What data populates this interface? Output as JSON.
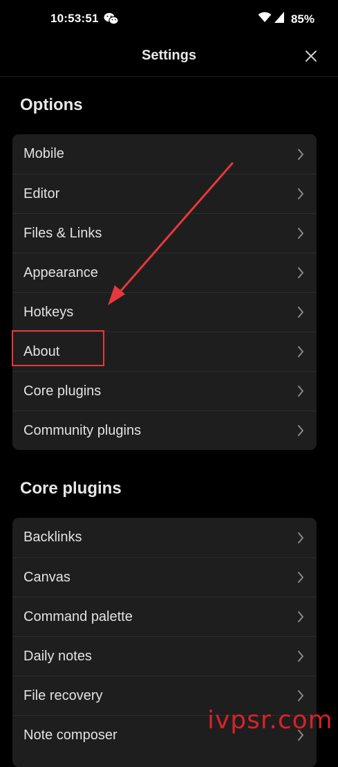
{
  "status_bar": {
    "time": "10:53:51",
    "battery": "85%",
    "icons": [
      "wechat-icon",
      "wifi-icon",
      "signal-icon"
    ]
  },
  "header": {
    "title": "Settings",
    "close_icon": "close-icon"
  },
  "options": {
    "title": "Options",
    "items": [
      {
        "label": "Mobile"
      },
      {
        "label": "Editor"
      },
      {
        "label": "Files & Links"
      },
      {
        "label": "Appearance"
      },
      {
        "label": "Hotkeys"
      },
      {
        "label": "About"
      },
      {
        "label": "Core plugins"
      },
      {
        "label": "Community plugins"
      }
    ]
  },
  "core_plugins": {
    "title": "Core plugins",
    "items": [
      {
        "label": "Backlinks"
      },
      {
        "label": "Canvas"
      },
      {
        "label": "Command palette"
      },
      {
        "label": "Daily notes"
      },
      {
        "label": "File recovery"
      },
      {
        "label": "Note composer"
      }
    ]
  },
  "annotation": {
    "highlight_color": "#e8383d",
    "arrow_color": "#e8383d"
  },
  "watermark": {
    "text": "ivpsr.com",
    "color": "#e8232b"
  },
  "colors": {
    "background": "#000000",
    "card": "#1e1e1e",
    "divider": "#2c2c2c",
    "text": "#e2e2e2",
    "chevron": "#8a8a8a"
  }
}
